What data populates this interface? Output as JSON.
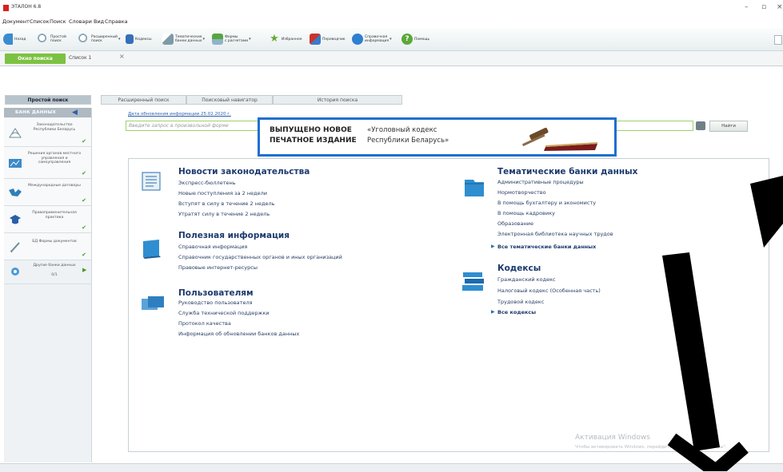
{
  "window": {
    "title": "ЭТАЛОН 6.8",
    "minimize": "–",
    "maximize": "▫",
    "close": "×"
  },
  "menu": [
    "Документ",
    "Список",
    "Поиск",
    "Словари",
    "Вид",
    "Справка"
  ],
  "toolbar": [
    {
      "label": "Назад",
      "icon": "back-arrow-icon",
      "color": "#3a8bd0"
    },
    {
      "label": "Простой\nпоиск",
      "icon": "search-icon",
      "color": "#8aa6b8"
    },
    {
      "label": "Расширенный\nпоиск",
      "icon": "advanced-search-icon",
      "color": "#8aa6b8"
    },
    {
      "label": "Кодексы",
      "icon": "codes-icon",
      "color": "#3670b8"
    },
    {
      "label": "Тематические\nбанки данных",
      "icon": "thematic-banks-icon",
      "color": "#7d9aa8"
    },
    {
      "label": "Формы\nс расчетами",
      "icon": "forms-icon",
      "color": "#56a640"
    },
    {
      "label": "Избранное",
      "icon": "favorites-star-icon",
      "color": "#6aa83a"
    },
    {
      "label": "Переводчик",
      "icon": "translator-icon",
      "color": "#c8342c"
    },
    {
      "label": "Справочная\nинформация",
      "icon": "info-icon",
      "color": "#2f7fd0"
    },
    {
      "label": "Помощь",
      "icon": "help-icon",
      "color": "#5aa83a"
    }
  ],
  "tabs": {
    "search_window": "Окно поиска",
    "list": "Список 1",
    "close": "×"
  },
  "subtabs": [
    "Простой поиск",
    "Расширенный поиск",
    "Поисковый навигатор",
    "История поиска"
  ],
  "sidebar": {
    "header": "БАНК ДАННЫХ",
    "items": [
      {
        "label": "Законодательство Республики Беларусь",
        "icon": "legislation-icon"
      },
      {
        "label": "Решения органов местного управления и самоуправления",
        "icon": "local-decisions-icon"
      },
      {
        "label": "Международные договоры",
        "icon": "international-treaties-icon"
      },
      {
        "label": "Правоприменительная практика",
        "icon": "law-practice-icon"
      },
      {
        "label": "БД Формы документов",
        "icon": "document-forms-icon"
      },
      {
        "label": "Другие банки данных",
        "icon": "other-banks-icon",
        "count": "0/1"
      }
    ]
  },
  "search": {
    "date_link": "Дата обновления информации 25.02.2020 г.",
    "placeholder": "Введите запрос в произвольной форме",
    "find_button": "Найти"
  },
  "banner": {
    "line1": "ВЫПУЩЕНО НОВОЕ",
    "line2": "ПЕЧАТНОЕ ИЗДАНИЕ",
    "quote1": "«Уголовный кодекс",
    "quote2": "Республики Беларусь»"
  },
  "sections": {
    "news": {
      "title": "Новости законодательства",
      "links": [
        "Экспресс-бюллетень",
        "Новые поступления за 2 недели",
        "Вступят в силу в течение 2 недель",
        "Утратят силу в течение 2 недель"
      ]
    },
    "useful": {
      "title": "Полезная информация",
      "links": [
        "Справочная информация",
        "Справочник государственных органов и иных организаций",
        "Правовые интернет-ресурсы"
      ]
    },
    "users": {
      "title": "Пользователям",
      "links": [
        "Руководство пользователя",
        "Служба технической поддержки",
        "Протокол качества",
        "Информация об обновлении банков данных"
      ]
    },
    "thematic": {
      "title": "Тематические банки данных",
      "links": [
        "Административные процедуры",
        "Нормотворчество",
        "В помощь бухгалтеру и экономисту",
        "В помощь кадровику",
        "Образование",
        "Электронная библиотека научных трудов"
      ],
      "all": "Все тематические банки данных"
    },
    "codes": {
      "title": "Кодексы",
      "links": [
        "Гражданский кодекс",
        "Налоговый кодекс (Особенная часть)",
        "Трудовой кодекс"
      ],
      "all": "Все кодексы"
    }
  },
  "watermark": {
    "line1": "Активация Windows",
    "line2": "Чтобы активировать Windows, перейдите в раздел \"Параметры\"."
  },
  "colors": {
    "accent_green": "#7cc242",
    "banner_border": "#1f6fd1",
    "link": "#1c3a6e"
  }
}
